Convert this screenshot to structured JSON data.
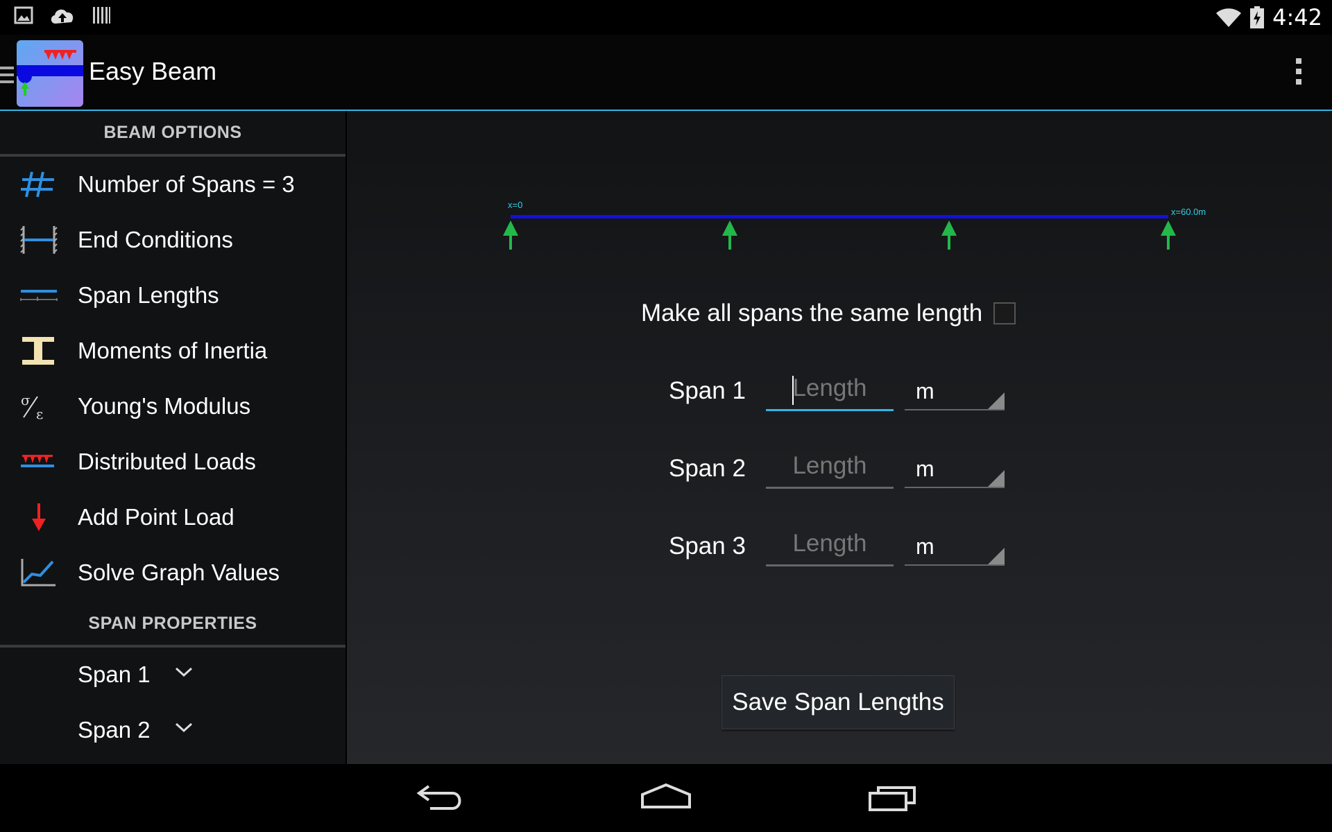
{
  "status_bar": {
    "time": "4:42",
    "left_icons": [
      "image-icon",
      "cloud-upload-icon",
      "barcode-icon"
    ],
    "right_icons": [
      "wifi-icon",
      "battery-charging-icon"
    ]
  },
  "action_bar": {
    "title": "Easy Beam",
    "icons": [
      "app-logo-icon",
      "overflow-menu-icon"
    ]
  },
  "drawer": {
    "beam_options_heading": "BEAM OPTIONS",
    "items": [
      {
        "label": "Number of Spans = 3",
        "icon": "hash-icon"
      },
      {
        "label": "End Conditions",
        "icon": "end-conditions-icon"
      },
      {
        "label": "Span Lengths",
        "icon": "span-lengths-icon"
      },
      {
        "label": "Moments of Inertia",
        "icon": "i-beam-icon"
      },
      {
        "label": "Young's Modulus",
        "icon": "stress-strain-icon"
      },
      {
        "label": "Distributed Loads",
        "icon": "distributed-load-icon"
      },
      {
        "label": "Add Point Load",
        "icon": "point-load-arrow-icon"
      },
      {
        "label": "Solve Graph Values",
        "icon": "graph-icon"
      }
    ],
    "span_properties_heading": "SPAN PROPERTIES",
    "span_items": [
      {
        "label": "Span 1"
      },
      {
        "label": "Span 2"
      }
    ]
  },
  "beam_diagram": {
    "start_label": "x=0",
    "end_label": "x=60.0m",
    "support_count": 4,
    "colors": {
      "beam": "#1010e0",
      "support": "#22b84a",
      "label": "#33d0e5"
    }
  },
  "form": {
    "same_length_label": "Make all spans the same length",
    "same_length_checked": false,
    "spans": [
      {
        "label": "Span 1",
        "placeholder": "Length",
        "value": "",
        "unit": "m"
      },
      {
        "label": "Span 2",
        "placeholder": "Length",
        "value": "",
        "unit": "m"
      },
      {
        "label": "Span 3",
        "placeholder": "Length",
        "value": "",
        "unit": "m"
      }
    ],
    "save_label": "Save Span Lengths"
  },
  "accent_color": "#33b5e5"
}
